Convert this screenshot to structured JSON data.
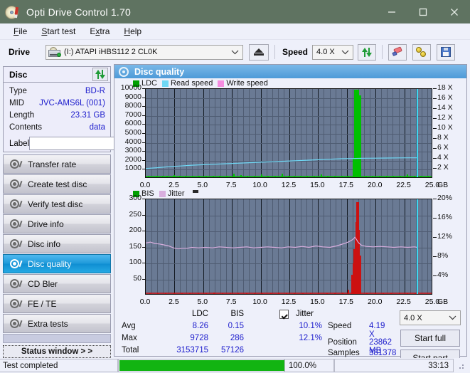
{
  "window": {
    "title": "Opti Drive Control 1.70",
    "icon": "disc-pen-icon",
    "minimize": "minimize-icon",
    "maximize": "maximize-icon",
    "close": "close-icon",
    "titlebar_color": "#5f7361"
  },
  "menu": [
    {
      "label": "File"
    },
    {
      "label": "Start test"
    },
    {
      "label": "Extra"
    },
    {
      "label": "Help"
    }
  ],
  "toolbar": {
    "drive_label": "Drive",
    "drive_value": "(I:)  ATAPI iHBS112  2 CL0K",
    "eject_icon": "eject-icon",
    "speed_label": "Speed",
    "speed_value": "4.0 X",
    "refresh_icon": "refresh-icon",
    "eraser_icon": "eraser-icon",
    "tools_icon": "tools-icon",
    "save_icon": "save-icon"
  },
  "disc": {
    "header": "Disc",
    "refresh_icon": "refresh-icon",
    "rows": [
      {
        "key": "Type",
        "value": "BD-R"
      },
      {
        "key": "MID",
        "value": "JVC-AMS6L (001)"
      },
      {
        "key": "Length",
        "value": "23.31 GB"
      },
      {
        "key": "Contents",
        "value": "data"
      }
    ],
    "label_key": "Label",
    "label_value": "",
    "label_placeholder": "",
    "label_button_icon": "disc-icon"
  },
  "sidebar": {
    "items": [
      {
        "label": "Transfer rate",
        "icon": "disc-test-icon",
        "active": false
      },
      {
        "label": "Create test disc",
        "icon": "disc-burn-icon",
        "active": false
      },
      {
        "label": "Verify test disc",
        "icon": "disc-verify-icon",
        "active": false
      },
      {
        "label": "Drive info",
        "icon": "disc-drive-icon",
        "active": false
      },
      {
        "label": "Disc info",
        "icon": "disc-info-icon",
        "active": false
      },
      {
        "label": "Disc quality",
        "icon": "disc-quality-icon",
        "active": true
      },
      {
        "label": "CD Bler",
        "icon": "disc-bler-icon",
        "active": false
      },
      {
        "label": "FE / TE",
        "icon": "disc-fete-icon",
        "active": false
      },
      {
        "label": "Extra tests",
        "icon": "disc-extra-icon",
        "active": false
      }
    ],
    "status_window_button": "Status window > >"
  },
  "panel": {
    "title": "Disc quality",
    "icon": "disc-quality-icon"
  },
  "results": {
    "col_ldc": "LDC",
    "col_bis": "BIS",
    "jitter_label": "Jitter",
    "jitter_checked": true,
    "row_avg": "Avg",
    "row_max": "Max",
    "row_total": "Total",
    "avg_ldc": "8.26",
    "avg_bis": "0.15",
    "avg_jitter": "10.1%",
    "max_ldc": "9728",
    "max_bis": "286",
    "max_jitter": "12.1%",
    "total_ldc": "3153715",
    "total_bis": "57126",
    "speed_key": "Speed",
    "speed_value": "4.19 X",
    "position_key": "Position",
    "position_value": "23862 MB",
    "samples_key": "Samples",
    "samples_value": "381378",
    "speed_select": "4.0 X",
    "start_full": "Start full",
    "start_part": "Start part"
  },
  "statusbar": {
    "message": "Test completed",
    "progress_percent": "100.0%",
    "progress_value": 100,
    "elapsed": "33:13"
  },
  "chart_data": [
    {
      "type": "area",
      "name": "top-chart-ldc-readspeed",
      "title": "Disc quality",
      "xlabel": "GB",
      "ylabel": "LDC",
      "xlim": [
        0.0,
        25.0
      ],
      "xticks": [
        "0.0",
        "2.5",
        "5.0",
        "7.5",
        "10.0",
        "12.5",
        "15.0",
        "17.5",
        "20.0",
        "22.5",
        "25.0"
      ],
      "x_unit": "GB",
      "ylim": [
        0,
        10000
      ],
      "yticks": [
        "1000",
        "2000",
        "3000",
        "4000",
        "5000",
        "6000",
        "7000",
        "8000",
        "9000",
        "10000"
      ],
      "y2lim": [
        0,
        18
      ],
      "y2ticks": [
        "2 X",
        "4 X",
        "6 X",
        "8 X",
        "10 X",
        "12 X",
        "14 X",
        "16 X",
        "18 X"
      ],
      "grid": true,
      "legend_position": "top-left",
      "legend": [
        {
          "label": "LDC",
          "color": "#00a000"
        },
        {
          "label": "Read speed",
          "color": "#6fd8f5"
        },
        {
          "label": "Write speed",
          "color": "#f58ce0"
        }
      ],
      "series": [
        {
          "name": "LDC",
          "color": "#00c000",
          "kind": "impulse",
          "x": [
            0.2,
            0.9,
            1.4,
            1.8,
            2.4,
            2.9,
            3.4,
            4.0,
            4.6,
            5.2,
            5.8,
            6.4,
            7.0,
            7.6,
            8.2,
            8.8,
            9.4,
            10.0,
            10.6,
            11.2,
            11.8,
            12.4,
            12.9,
            13.4,
            14.0,
            14.6,
            15.2,
            15.8,
            16.4,
            17.0,
            17.6,
            18.0,
            18.15,
            18.25,
            18.3,
            18.4,
            18.5,
            18.6,
            19.1,
            19.7,
            20.3,
            20.9,
            21.5,
            22.1,
            22.7,
            23.3,
            23.9,
            24.5
          ],
          "y": [
            120,
            140,
            130,
            150,
            260,
            130,
            160,
            140,
            130,
            150,
            180,
            140,
            130,
            420,
            200,
            140,
            130,
            330,
            150,
            140,
            430,
            130,
            140,
            150,
            130,
            140,
            320,
            130,
            150,
            140,
            190,
            2100,
            9728,
            9500,
            9728,
            8200,
            9100,
            1800,
            150,
            130,
            140,
            150,
            130,
            140,
            300,
            130,
            140,
            150
          ]
        },
        {
          "name": "Read speed",
          "color": "#6fd8f5",
          "kind": "line",
          "x": [
            0.0,
            1.0,
            2.0,
            3.0,
            4.0,
            5.0,
            6.0,
            7.0,
            8.0,
            9.0,
            10.0,
            11.0,
            12.0,
            13.0,
            14.0,
            15.0,
            16.0,
            17.0,
            18.0,
            19.0,
            20.0,
            21.0,
            22.0,
            23.0,
            23.6
          ],
          "y": [
            2.05,
            2.2,
            2.4,
            2.55,
            2.7,
            2.8,
            2.9,
            3.0,
            3.1,
            3.2,
            3.3,
            3.4,
            3.5,
            3.6,
            3.7,
            3.8,
            3.9,
            4.0,
            4.05,
            4.1,
            4.12,
            4.15,
            4.17,
            4.19,
            4.19
          ],
          "axis": "y2"
        }
      ],
      "cursor_x": 23.6,
      "cursor_color": "#3fd6f0"
    },
    {
      "type": "area",
      "name": "bottom-chart-bis-jitter",
      "xlabel": "GB",
      "ylabel": "BIS",
      "xlim": [
        0.0,
        25.0
      ],
      "xticks": [
        "0.0",
        "2.5",
        "5.0",
        "7.5",
        "10.0",
        "12.5",
        "15.0",
        "17.5",
        "20.0",
        "22.5",
        "25.0"
      ],
      "x_unit": "GB",
      "ylim": [
        0,
        300
      ],
      "yticks": [
        "50",
        "100",
        "150",
        "200",
        "250",
        "300"
      ],
      "y2lim": [
        0,
        20
      ],
      "y2ticks": [
        "4%",
        "8%",
        "12%",
        "16%",
        "20%"
      ],
      "grid": true,
      "legend_position": "top-left",
      "legend": [
        {
          "label": "BIS",
          "color": "#00a000"
        },
        {
          "label": "Jitter",
          "color": "#d9aede"
        }
      ],
      "series": [
        {
          "name": "BIS",
          "color": "#cc1111",
          "kind": "impulse",
          "x": [
            0.3,
            1.0,
            1.7,
            2.4,
            3.1,
            3.8,
            4.5,
            5.2,
            5.9,
            6.6,
            7.3,
            8.0,
            8.7,
            9.4,
            10.1,
            10.8,
            11.5,
            12.2,
            12.9,
            13.6,
            14.3,
            15.0,
            15.7,
            16.4,
            17.1,
            17.6,
            17.9,
            18.0,
            18.1,
            18.2,
            18.25,
            18.3,
            18.35,
            18.4,
            18.5,
            18.6,
            19.2,
            19.9,
            20.6,
            21.3,
            22.0,
            22.7,
            23.4
          ],
          "y": [
            2,
            3,
            2,
            3,
            2,
            3,
            2,
            3,
            4,
            2,
            3,
            2,
            3,
            2,
            3,
            2,
            4,
            2,
            3,
            2,
            3,
            2,
            3,
            2,
            4,
            14,
            60,
            95,
            140,
            175,
            225,
            286,
            200,
            165,
            120,
            40,
            3,
            2,
            3,
            2,
            3,
            2,
            3
          ]
        },
        {
          "name": "Jitter",
          "color": "#d9aede",
          "kind": "line",
          "axis": "y2",
          "x": [
            0.0,
            0.4,
            0.8,
            1.2,
            1.6,
            2.0,
            2.4,
            2.8,
            3.2,
            3.6,
            4.0,
            4.6,
            5.2,
            5.8,
            6.4,
            7.0,
            7.6,
            8.2,
            8.8,
            9.4,
            10.0,
            10.6,
            11.2,
            11.8,
            12.4,
            13.0,
            13.6,
            14.2,
            14.8,
            15.4,
            16.0,
            16.6,
            17.0,
            17.4,
            17.7,
            18.0,
            18.2,
            18.35,
            18.5,
            18.8,
            19.2,
            19.8,
            20.4,
            21.0,
            21.6,
            22.2,
            22.8,
            23.4,
            23.6
          ],
          "y": [
            10.9,
            11.1,
            10.8,
            10.7,
            10.5,
            10.3,
            9.9,
            9.7,
            9.8,
            9.8,
            10.0,
            9.9,
            10.0,
            9.9,
            10.1,
            10.0,
            9.9,
            10.0,
            10.1,
            9.9,
            10.0,
            10.1,
            10.0,
            9.9,
            10.1,
            10.0,
            10.2,
            10.0,
            10.3,
            10.1,
            10.0,
            10.3,
            10.6,
            10.9,
            11.2,
            11.6,
            12.1,
            11.6,
            11.0,
            10.4,
            10.2,
            10.1,
            10.2,
            10.1,
            10.0,
            10.1,
            10.0,
            10.1,
            10.0
          ]
        }
      ],
      "cursor_x": 23.6,
      "cursor_color": "#3fd6f0"
    }
  ]
}
